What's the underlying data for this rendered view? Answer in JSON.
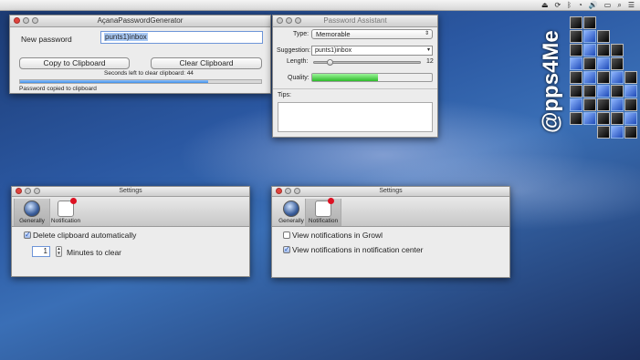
{
  "menubar": {
    "apple": "",
    "status": [
      "⏏",
      "⟳",
      "ᛒ",
      "◔",
      "🔊",
      "▭",
      "⌕",
      "☰"
    ]
  },
  "generator": {
    "title": "AçanaPasswordGenerator",
    "password_label": "New password",
    "password_value": "punts1)inbox",
    "copy_button": "Copy to Clipboard",
    "clear_button": "Clear Clipboard",
    "countdown_text": "Seconds left to clear clipboard: 44",
    "progress": 0.78,
    "status_text": "Password copied to clipboard"
  },
  "assistant": {
    "title": "Password Assistant",
    "type_label": "Type:",
    "type_value": "Memorable",
    "suggestion_label": "Suggestion:",
    "suggestion_value": "punts1)inbox",
    "length_label": "Length:",
    "length_value": "12",
    "length_fraction": 0.15,
    "quality_label": "Quality:",
    "quality_fraction": 0.55,
    "tips_label": "Tips:"
  },
  "settings_left": {
    "title": "Settings",
    "tab_general": "Generally",
    "tab_notification": "Notification",
    "delete_checkbox": "Delete clipboard automatically",
    "minutes_value": "1",
    "minutes_label": "Minutes to clear"
  },
  "settings_right": {
    "title": "Settings",
    "tab_general": "Generally",
    "tab_notification": "Notification",
    "growl_checkbox": "View notifications in Growl",
    "center_checkbox": "View notifications in notification center"
  },
  "watermark": {
    "text": "@pps4Me"
  },
  "colors": {
    "progress_fill": "#3f8fe5",
    "quality_fill": "#3fd13a",
    "selection": "#a9c9f5"
  }
}
